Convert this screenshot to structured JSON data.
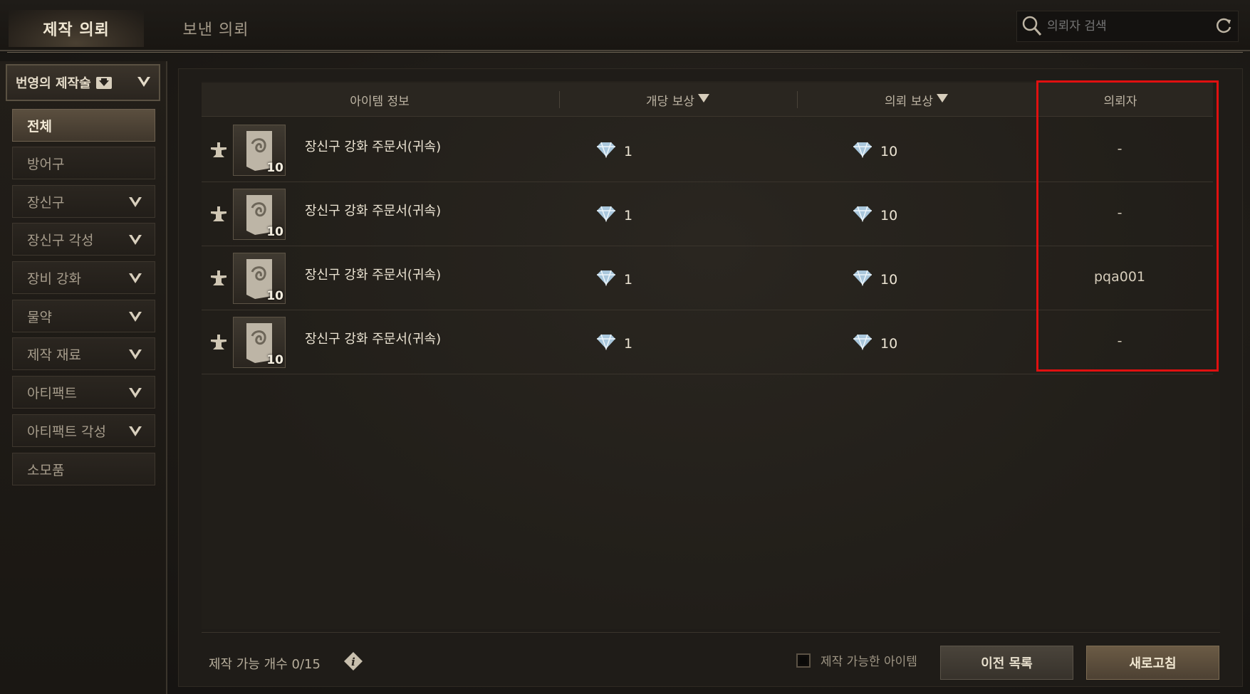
{
  "tabs": [
    {
      "label": "제작 의뢰",
      "active": true
    },
    {
      "label": "보낸 의뢰",
      "active": false
    }
  ],
  "search": {
    "placeholder": "의뢰자 검색"
  },
  "sidebar": {
    "category_dropdown": "번영의 제작술",
    "items": [
      {
        "label": "전체",
        "active": true,
        "expandable": false
      },
      {
        "label": "방어구",
        "active": false,
        "expandable": false
      },
      {
        "label": "장신구",
        "active": false,
        "expandable": true
      },
      {
        "label": "장신구 각성",
        "active": false,
        "expandable": true
      },
      {
        "label": "장비 강화",
        "active": false,
        "expandable": true
      },
      {
        "label": "물약",
        "active": false,
        "expandable": true
      },
      {
        "label": "제작 재료",
        "active": false,
        "expandable": true
      },
      {
        "label": "아티팩트",
        "active": false,
        "expandable": true
      },
      {
        "label": "아티팩트 각성",
        "active": false,
        "expandable": true
      },
      {
        "label": "소모품",
        "active": false,
        "expandable": false
      }
    ]
  },
  "table": {
    "headers": {
      "item_info": "아이템 정보",
      "unit_reward": "개당 보상",
      "request_reward": "의뢰 보상",
      "requester": "의뢰자"
    },
    "rows": [
      {
        "item_name": "장신구 강화 주문서(귀속)",
        "quantity": "10",
        "unit_reward": "1",
        "request_reward": "10",
        "requester": "-"
      },
      {
        "item_name": "장신구 강화 주문서(귀속)",
        "quantity": "10",
        "unit_reward": "1",
        "request_reward": "10",
        "requester": "-"
      },
      {
        "item_name": "장신구 강화 주문서(귀속)",
        "quantity": "10",
        "unit_reward": "1",
        "request_reward": "10",
        "requester": "pqa001"
      },
      {
        "item_name": "장신구 강화 주문서(귀속)",
        "quantity": "10",
        "unit_reward": "1",
        "request_reward": "10",
        "requester": "-"
      }
    ]
  },
  "footer": {
    "craft_count": "제작 가능 개수 0/15",
    "filter_checkbox_label": "제작 가능한 아이템",
    "prev_button": "이전 목록",
    "refresh_button": "새로고침"
  },
  "colors": {
    "highlight_box": "#e01010",
    "active_tab": "#efe6d2",
    "refresh_button": "#6b5b45"
  }
}
